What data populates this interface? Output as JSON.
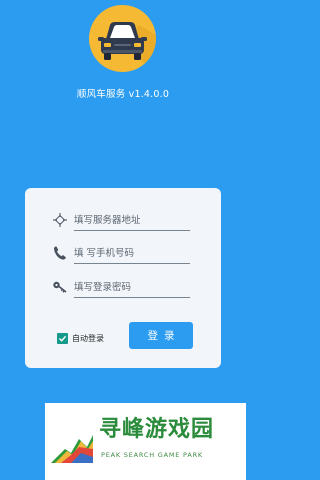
{
  "app": {
    "title": "顺风车服务 v1.4.0.0",
    "logo_icon": "car-icon",
    "background_color": "#2b9cf0",
    "logo_color": "#f6b934"
  },
  "login_form": {
    "server_field": {
      "placeholder": "填写服务器地址",
      "value": "",
      "icon": "crosshair-icon"
    },
    "phone_field": {
      "placeholder": "填 写手机号码",
      "value": "",
      "icon": "phone-icon"
    },
    "password_field": {
      "placeholder": "填写登录密码",
      "value": "",
      "icon": "key-icon"
    },
    "auto_login": {
      "label": "自动登录",
      "checked": true
    },
    "login_button": "登录",
    "button_color": "#2b9cf0",
    "checkbox_color": "#159a8c"
  },
  "watermark": {
    "title": "寻峰游戏园",
    "subtitle": "PEAK SEARCH GAME PARK"
  }
}
